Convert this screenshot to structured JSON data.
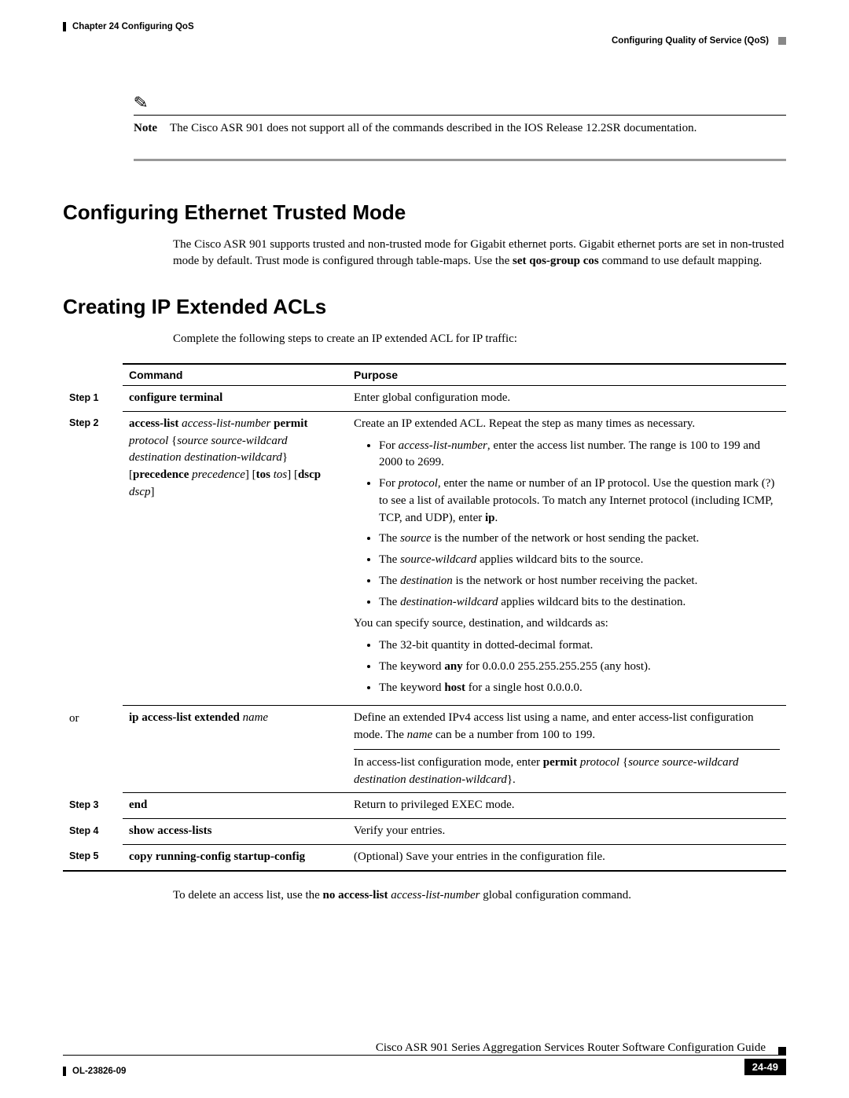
{
  "header": {
    "chapter": "Chapter 24    Configuring QoS",
    "section": "Configuring Quality of Service (QoS)"
  },
  "note": {
    "label": "Note",
    "text": "The Cisco ASR 901 does not support all of the commands described in the IOS Release 12.2SR documentation."
  },
  "sections": {
    "s1_title": "Configuring Ethernet Trusted Mode",
    "s1_body_prefix": "The Cisco ASR 901 supports trusted and non-trusted mode for Gigabit ethernet ports. Gigabit ethernet ports are set in non-trusted mode by default. Trust mode is configured through table-maps. Use the ",
    "s1_body_bold": "set qos-group cos",
    "s1_body_suffix": " command to use default mapping.",
    "s2_title": "Creating IP Extended ACLs",
    "s2_body": "Complete the following steps to create an IP extended ACL for IP traffic:"
  },
  "table": {
    "headers": {
      "command": "Command",
      "purpose": "Purpose"
    },
    "steps": {
      "step1": "Step 1",
      "step2": "Step 2",
      "or": "or",
      "step3": "Step 3",
      "step4": "Step 4",
      "step5": "Step 5"
    },
    "row1": {
      "cmd": "configure terminal",
      "purpose": "Enter global configuration mode."
    },
    "row2": {
      "cmd_b1": "access-list",
      "cmd_i1": "access-list-number",
      "cmd_b2": "permit",
      "cmd_i2": "protocol",
      "cmd_open": "{",
      "cmd_i3": "source source-wildcard destination destination-wildcard",
      "cmd_close": "}",
      "cmd_opt_b1": "precedence",
      "cmd_opt_i1": "precedence",
      "cmd_opt_b2": "tos",
      "cmd_opt_i2": "tos",
      "cmd_opt_b3": "dscp",
      "cmd_opt_i3": "dscp",
      "p_top": "Create an IP extended ACL. Repeat the step as many times as necessary.",
      "b1a": "For ",
      "b1i": "access-list-number",
      "b1b": ", enter the access list number. The range is 100 to 199 and 2000 to 2699.",
      "b2a": "For ",
      "b2i": "protocol",
      "b2b": ", enter the name or number of an IP protocol. Use the question mark (?) to see a list of available protocols. To match any Internet protocol (including ICMP, TCP, and UDP), enter ",
      "b2ip": "ip",
      "b2c": ".",
      "b3a": "The ",
      "b3i": "source",
      "b3b": " is the number of the network or host sending the packet.",
      "b4a": "The ",
      "b4i": "source-wildcard",
      "b4b": " applies wildcard bits to the source.",
      "b5a": "The ",
      "b5i": "destination",
      "b5b": " is the network or host number receiving the packet.",
      "b6a": "The ",
      "b6i": "destination-wildcard",
      "b6b": " applies wildcard bits to the destination.",
      "mid": "You can specify source, destination, and wildcards as:",
      "b7": "The 32-bit quantity in dotted-decimal format.",
      "b8a": "The keyword ",
      "b8b": "any",
      "b8c": " for 0.0.0.0 255.255.255.255 (any host).",
      "b9a": "The keyword ",
      "b9b": "host",
      "b9c": " for a single host 0.0.0.0."
    },
    "row_or": {
      "cmd_b": "ip access-list extended",
      "cmd_i": "name",
      "p1a": "Define an extended IPv4 access list using a name, and enter access-list configuration mode. The ",
      "p1i": "name",
      "p1b": " can be a number from 100 to 199.",
      "p2a": "In access-list configuration mode, enter ",
      "p2b": "permit",
      "p2i": " protocol",
      "p2open": " {",
      "p2i2": "source source-wildcard destination destination-wildcard",
      "p2close": "}."
    },
    "row3": {
      "cmd": "end",
      "purpose": "Return to privileged EXEC mode."
    },
    "row4": {
      "cmd": "show access-lists",
      "purpose": "Verify your entries."
    },
    "row5": {
      "cmd": "copy running-config startup-config",
      "purpose": "(Optional) Save your entries in the configuration file."
    }
  },
  "after_table": {
    "a": "To delete an access list, use the ",
    "b": "no access-list",
    "i": " access-list-number",
    "c": " global configuration command."
  },
  "footer": {
    "guide": "Cisco ASR 901 Series Aggregation Services Router Software Configuration Guide",
    "docnum": "OL-23826-09",
    "page": "24-49"
  }
}
